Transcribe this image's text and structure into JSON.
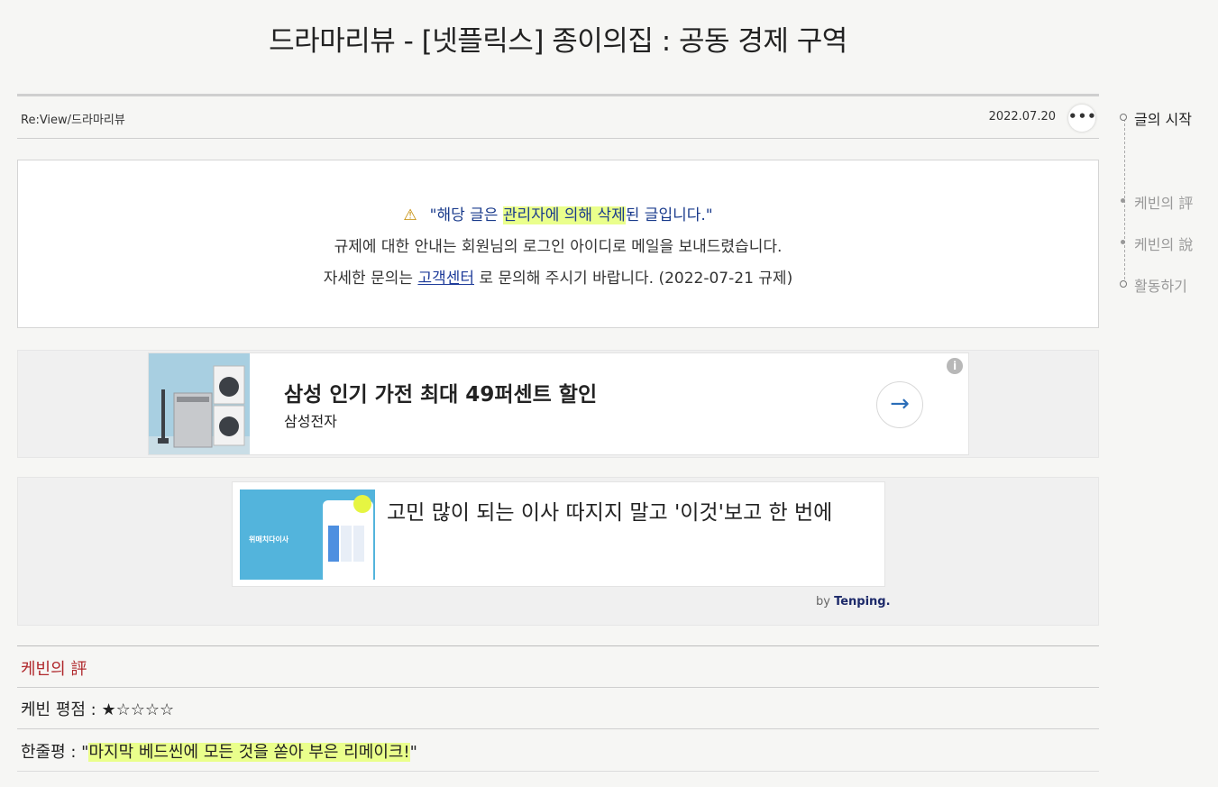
{
  "page": {
    "title": "드라마리뷰 - [넷플릭스] 종이의집 : 공동 경제 구역"
  },
  "meta": {
    "category": "Re:View/드라마리뷰",
    "date": "2022.07.20",
    "more_label": "•••"
  },
  "notice": {
    "line1_prefix": "\"해당 글은 ",
    "line1_highlight": "관리자에 의해 삭제",
    "line1_suffix": "된 글입니다.\"",
    "line2": "규제에 대한 안내는 회원님의 로그인 아이디로 메일을 보내드렸습니다.",
    "line3_prefix": "자세한 문의는 ",
    "line3_link": "고객센터",
    "line3_suffix": " 로 문의해 주시기 바랍니다. (2022-07-21 규제)"
  },
  "ad1": {
    "title": "삼성 인기 가전 최대 49퍼센트 할인",
    "advertiser": "삼성전자",
    "arrow": "→",
    "info": "i"
  },
  "ad2": {
    "title": "고민 많이 되는 이사 따지지 말고 '이것'보고 한 번에",
    "by_prefix": "by ",
    "by_brand": "Tenping",
    "by_suffix": ".",
    "thumb_caption": "위매치다이사"
  },
  "review": {
    "section_title": "케빈의 評",
    "rating_label": "케빈 평점 : ",
    "rating_stars": "★☆☆☆☆",
    "rating_value": 1,
    "oneline_label": "한줄평 : \"",
    "oneline_text": "마지막 베드씬에 모든 것을 쏟아 부은 리메이크!",
    "oneline_suffix": "\""
  },
  "toc": {
    "items": [
      "글의 시작",
      "케빈의 評",
      "케빈의 說",
      "활동하기"
    ]
  },
  "colors": {
    "accent_red": "#b0282c",
    "highlight": "#eaff8c",
    "link_blue": "#1f3c9a"
  }
}
